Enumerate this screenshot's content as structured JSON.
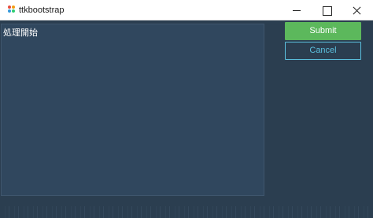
{
  "window": {
    "title": "ttkbootstrap",
    "icon": "ttkbootstrap-logo-icon"
  },
  "log": {
    "text": "処理開始"
  },
  "buttons": {
    "submit_label": "Submit",
    "cancel_label": "Cancel"
  },
  "colors": {
    "background": "#2b3e50",
    "log_background": "#30475e",
    "submit": "#5cb85c",
    "cancel": "#5bc0de"
  }
}
